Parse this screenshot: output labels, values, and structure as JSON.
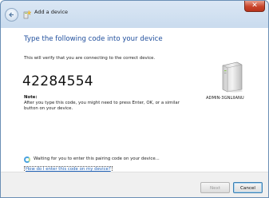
{
  "window": {
    "title": "Add a device",
    "close_label": "✕"
  },
  "main": {
    "heading": "Type the following code into your device",
    "subtext": "This will verify that you are connecting to the correct device.",
    "code": "42284554",
    "note_label": "Note:",
    "note_text": "After you type this code, you might need to press Enter, OK, or a similar button on your device.",
    "device_name": "ADMIN-3GNLIIANU",
    "waiting_text": "Waiting for you to enter this pairing code on your device...",
    "help_link": "How do I enter this code on my device?"
  },
  "footer": {
    "next_label": "Next",
    "cancel_label": "Cancel"
  },
  "icons": {
    "back": "back-arrow-icon",
    "title": "add-device-icon",
    "device": "computer-tower-icon",
    "spinner": "busy-spinner-icon"
  },
  "colors": {
    "heading": "#1f4e9c",
    "link": "#1b5fb8",
    "close": "#c9452b"
  }
}
